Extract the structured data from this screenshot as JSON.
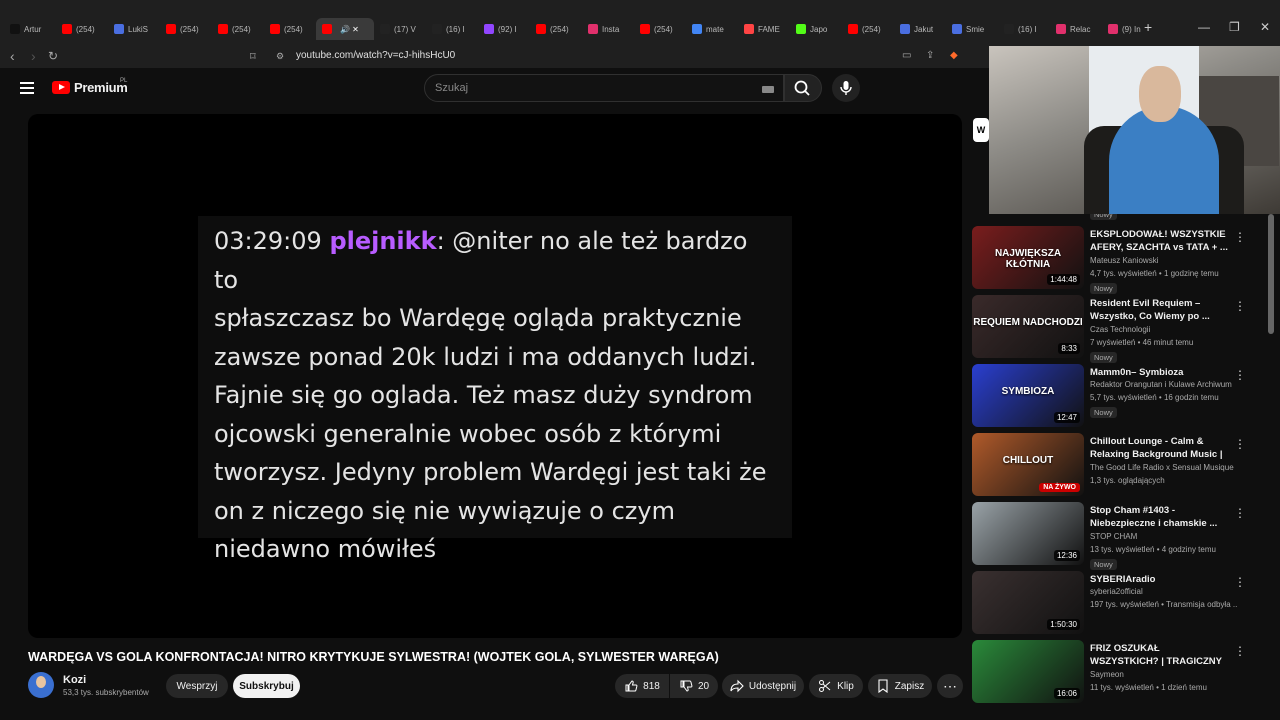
{
  "browser": {
    "tabs": [
      {
        "label": "Artur",
        "color": "#111111"
      },
      {
        "label": "(254)",
        "color": "#ff0000"
      },
      {
        "label": "LukiS",
        "color": "#4a6ee0"
      },
      {
        "label": "(254)",
        "color": "#ff0000"
      },
      {
        "label": "(254)",
        "color": "#ff0000"
      },
      {
        "label": "(254)",
        "color": "#ff0000"
      },
      {
        "label": "",
        "color": "#ff0000",
        "active": true
      },
      {
        "label": "(17) V",
        "color": "#222222"
      },
      {
        "label": "(16) I",
        "color": "#222222"
      },
      {
        "label": "(92) I",
        "color": "#9146ff"
      },
      {
        "label": "(254)",
        "color": "#ff0000"
      },
      {
        "label": "Insta",
        "color": "#e1306c"
      },
      {
        "label": "(254)",
        "color": "#ff0000"
      },
      {
        "label": "mate",
        "color": "#4285f4"
      },
      {
        "label": "FAME",
        "color": "#ff4444"
      },
      {
        "label": "Japo",
        "color": "#53fc18"
      },
      {
        "label": "(254)",
        "color": "#ff0000"
      },
      {
        "label": "Jakut",
        "color": "#4a6ee0"
      },
      {
        "label": "Smie",
        "color": "#4a6ee0"
      },
      {
        "label": "(16) I",
        "color": "#222222"
      },
      {
        "label": "Relac",
        "color": "#e1306c"
      },
      {
        "label": "(9) In",
        "color": "#e1306c"
      }
    ],
    "url": "youtube.com/watch?v=cJ-hihsHcU0"
  },
  "header": {
    "brand": "Premium",
    "region": "PL",
    "search_placeholder": "Szukaj"
  },
  "video": {
    "chat_time": "03:29:09",
    "chat_user": "plejnikk",
    "chat_lines": [
      ": @niter no ale też bardzo to",
      "spłaszczasz bo Wardęgę ogląda praktycznie",
      "zawsze ponad 20k ludzi i ma oddanych ludzi.",
      "Fajnie się go oglada. Też masz duży syndrom",
      "ojcowski generalnie wobec osób z którymi",
      "tworzysz. Jedyny problem Wardęgi jest taki że",
      "on z niczego się nie wywiązuje o czym",
      "niedawno mówiłeś"
    ],
    "title": "WARDĘGA VS GOLA KONFRONTACJA! NITRO KRYTYKUJE SYLWESTRA! (WOJTEK GOLA, SYLWESTER WARĘGA)",
    "channel": "Kozi",
    "subscribers": "53,3 tys. subskrybentów",
    "support_label": "Wesprzyj",
    "subscribe_label": "Subskrybuj",
    "likes": "818",
    "dislikes": "20",
    "share_label": "Udostępnij",
    "clip_label": "Klip",
    "save_label": "Zapisz"
  },
  "sidebar": {
    "partial_badge": "Nowy",
    "partial_top_letter": "W",
    "recommendations": [
      {
        "title": "EKSPLODOWAŁ! WSZYSTKIE AFERY, SZACHTA vs TATA + ...",
        "channel": "Mateusz Kaniowski",
        "meta": "4,7 tys. wyświetleń • 1 godzinę temu",
        "badge": "Nowy",
        "duration": "1:44:48",
        "thumb_text": "NAJWIĘKSZA KŁÓTNIA",
        "thumb_color": "#7a1d1d"
      },
      {
        "title": "Resident Evil Requiem – Wszystko, Co Wiemy po ...",
        "channel": "Czas Technologii",
        "meta": "7 wyświetleń • 46 minut temu",
        "badge": "Nowy",
        "duration": "8:33",
        "thumb_text": "REQUIEM NADCHODZI",
        "thumb_color": "#3a2a2a"
      },
      {
        "title": "Mamm0n– Symbioza",
        "channel": "Redaktor Orangutan i Kulawe Archiwum",
        "meta": "5,7 tys. wyświetleń • 16 godzin temu",
        "badge": "Nowy",
        "duration": "12:47",
        "thumb_text": "SYMBIOZA",
        "thumb_color": "#2a3fd0"
      },
      {
        "title": "Chillout Lounge - Calm & Relaxing Background Music | ...",
        "channel": "The Good Life Radio x Sensual Musique",
        "meta": "1,3 tys. oglądających",
        "badge": "",
        "duration": "",
        "live": "NA ŻYWO",
        "thumb_text": "CHILLOUT",
        "thumb_color": "#b05a2a"
      },
      {
        "title": "Stop Cham #1403 - Niebezpieczne i chamskie ...",
        "channel": "STOP CHAM",
        "meta": "13 tys. wyświetleń • 4 godziny temu",
        "badge": "Nowy",
        "duration": "12:36",
        "thumb_text": "",
        "thumb_color": "#9aa3a8"
      },
      {
        "title": "SYBERIAradio",
        "channel": "syberia2official",
        "meta": "197 tys. wyświetleń • Transmisja odbyła ...",
        "badge": "",
        "duration": "1:50:30",
        "thumb_text": "",
        "thumb_color": "#3a3030"
      },
      {
        "title": "FRIZ OSZUKAŁ WSZYSTKICH? | TRAGICZNY Upadek FAZY",
        "channel": "Saymeon",
        "meta": "11 tys. wyświetleń • 1 dzień temu",
        "badge": "",
        "duration": "16:06",
        "thumb_text": "",
        "thumb_color": "#2a8a3a"
      }
    ]
  }
}
